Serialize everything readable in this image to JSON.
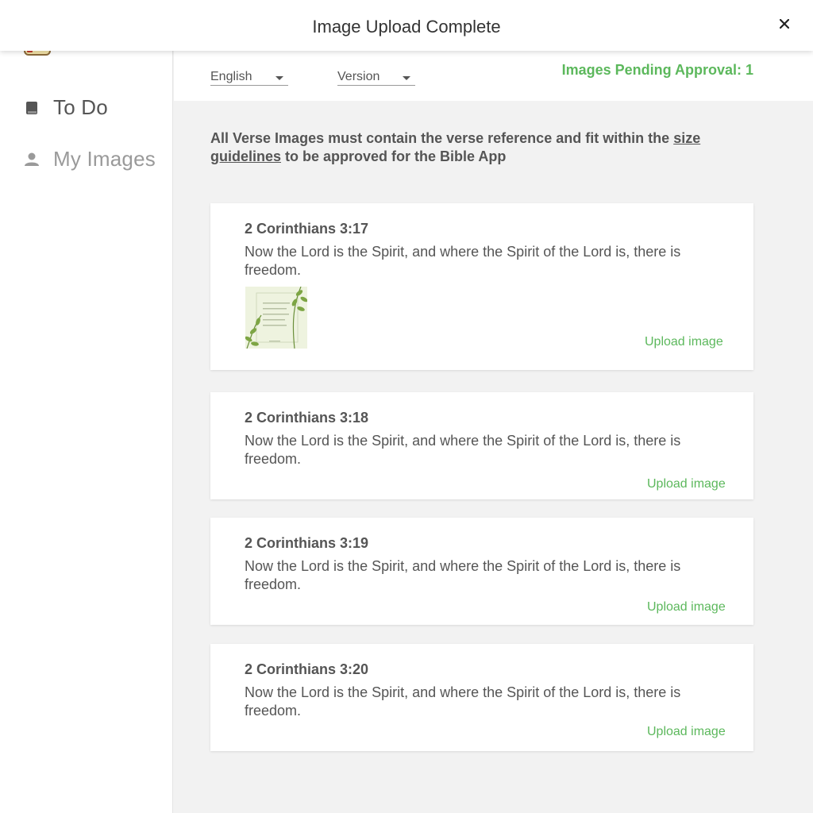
{
  "modal": {
    "title": "Image Upload Complete",
    "close_icon": "close-icon"
  },
  "sidebar": {
    "logo_icon": "bible-app-logo",
    "items": [
      {
        "label": "To Do",
        "icon": "book-icon"
      },
      {
        "label": "My Images",
        "icon": "person-icon"
      }
    ]
  },
  "filters": {
    "language": "English",
    "version": "Version",
    "pending": "Images Pending Approval: 1"
  },
  "notice": {
    "text_before": "All Verse Images must contain the verse reference and fit within the ",
    "link": "size guidelines",
    "text_after": " to be approved for the Bible App"
  },
  "colors": {
    "accent": "#5cb85c",
    "text": "#555555"
  },
  "verses": [
    {
      "reference": "2 Corinthians 3:17",
      "text": "Now the Lord is the Spirit, and where the Spirit of the Lord is, there is freedom.",
      "upload_label": "Upload image"
    },
    {
      "reference": "2 Corinthians 3:18",
      "text": "Now the Lord is the Spirit, and where the Spirit of the Lord is, there is freedom.",
      "upload_label": "Upload image"
    },
    {
      "reference": "2 Corinthians 3:19",
      "text": "Now the Lord is the Spirit, and where the Spirit of the Lord is, there is freedom.",
      "upload_label": "Upload image"
    },
    {
      "reference": "2 Corinthians 3:20",
      "text": "Now the Lord is the Spirit, and where the Spirit of the Lord is, there is freedom.",
      "upload_label": "Upload image"
    }
  ]
}
